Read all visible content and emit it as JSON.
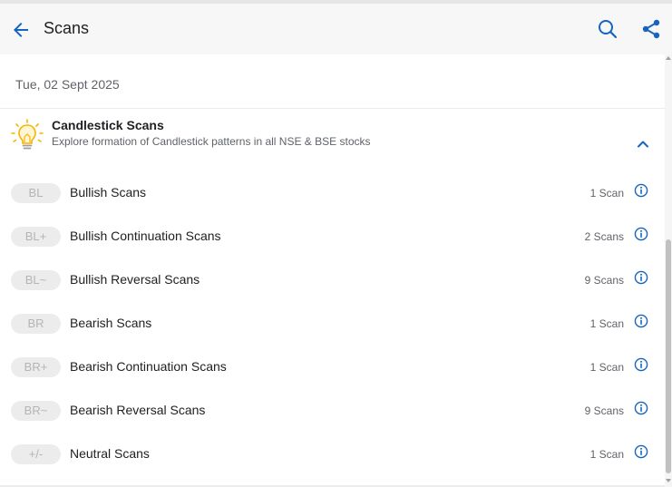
{
  "header": {
    "title": "Scans",
    "back_icon": "arrow-left-icon",
    "search_icon": "search-icon",
    "share_icon": "share-icon"
  },
  "date": "Tue, 02 Sept 2025",
  "section": {
    "icon": "lightbulb-icon",
    "title": "Candlestick Scans",
    "subtitle": "Explore formation of Candlestick patterns in all NSE & BSE stocks",
    "toggle_icon": "chevron-up-icon"
  },
  "rows": [
    {
      "badge": "BL",
      "label": "Bullish Scans",
      "count": "1 Scan"
    },
    {
      "badge": "BL+",
      "label": "Bullish Continuation Scans",
      "count": "2 Scans"
    },
    {
      "badge": "BL~",
      "label": "Bullish Reversal Scans",
      "count": "9 Scans"
    },
    {
      "badge": "BR",
      "label": "Bearish Scans",
      "count": "1 Scan"
    },
    {
      "badge": "BR+",
      "label": "Bearish Continuation Scans",
      "count": "1 Scan"
    },
    {
      "badge": "BR~",
      "label": "Bearish Reversal Scans",
      "count": "9 Scans"
    },
    {
      "badge": "+/-",
      "label": "Neutral Scans",
      "count": "1 Scan"
    }
  ],
  "colors": {
    "accent": "#1565c0",
    "header_bg": "#f7f7f7",
    "badge_bg": "#ececec",
    "bulb": "#f5b400"
  }
}
